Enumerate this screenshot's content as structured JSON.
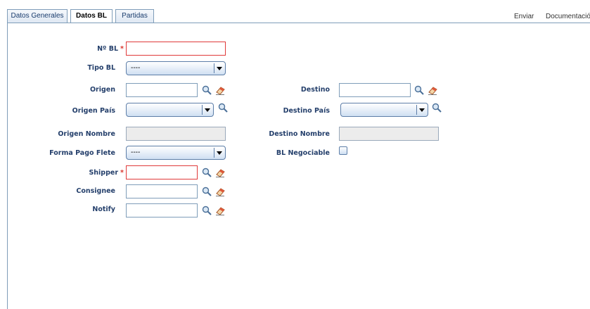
{
  "tabs": [
    {
      "label": "Datos Generales",
      "active": false
    },
    {
      "label": "Datos BL",
      "active": true
    },
    {
      "label": "Partidas",
      "active": false
    }
  ],
  "top_links": {
    "enviar": "Enviar",
    "documentacion": "Documentación"
  },
  "form": {
    "no_bl": {
      "label": "Nº BL",
      "required_mark": "*",
      "value": ""
    },
    "tipo_bl": {
      "label": "Tipo BL",
      "selected": "----"
    },
    "origen": {
      "label": "Origen",
      "value": ""
    },
    "destino": {
      "label": "Destino",
      "value": ""
    },
    "origen_pais": {
      "label": "Origen País",
      "selected": ""
    },
    "destino_pais": {
      "label": "Destino País",
      "selected": ""
    },
    "origen_nombre": {
      "label": "Origen Nombre",
      "value": ""
    },
    "destino_nombre": {
      "label": "Destino Nombre",
      "value": ""
    },
    "forma_pago_flete": {
      "label": "Forma Pago Flete",
      "selected": "----"
    },
    "bl_negociable": {
      "label": "BL Negociable",
      "checked": false
    },
    "shipper": {
      "label": "Shipper",
      "required_mark": "*",
      "value": ""
    },
    "consignee": {
      "label": "Consignee",
      "value": ""
    },
    "notify": {
      "label": "Notify",
      "value": ""
    }
  },
  "icons": {
    "search": "magnifier-icon",
    "edit": "eraser-edit-icon"
  },
  "colors": {
    "label": "#243f6b",
    "required": "#d9342b",
    "border": "#7f9db9"
  }
}
